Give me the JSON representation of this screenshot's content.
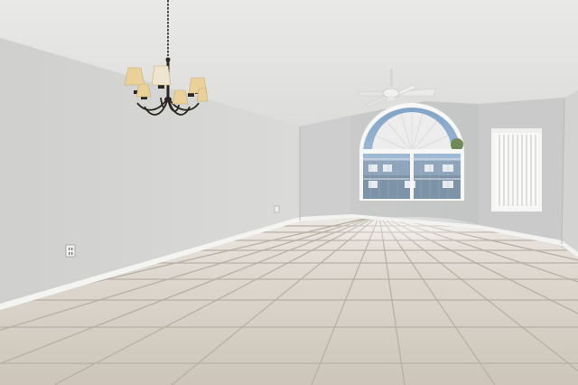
{
  "scene": {
    "description_label": "",
    "colors": {
      "ceiling": "#e2e2e0",
      "left_wall": "#d4d4d2",
      "back_wall": "#c7c8c6",
      "right_wall": "#cfd0ce",
      "floor": "#d6d0c8",
      "grout": "#b9b2a8",
      "baseboard": "#f4f4f2",
      "window_frame": "#f7f7f5",
      "sky": "#8fb0cf",
      "lamp_shade": "#e7cf9b",
      "fixture_metal": "#2a2622",
      "fan": "#e9e9e7"
    },
    "objects": [
      "chandelier",
      "ceiling-fan",
      "arched-window",
      "side-window",
      "outlet",
      "tile-floor"
    ]
  }
}
